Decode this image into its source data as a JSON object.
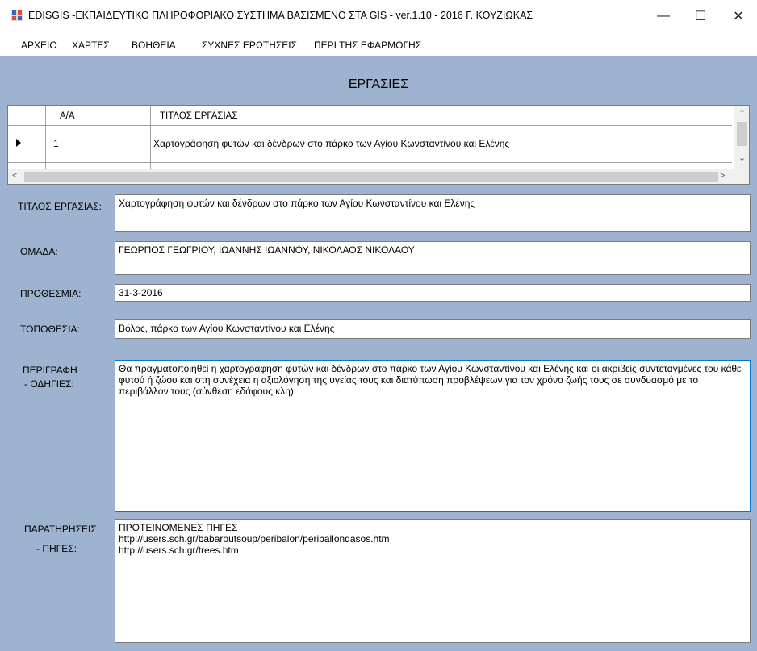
{
  "window": {
    "title": "EDISGIS -ΕΚΠΑΙΔΕΥΤΙΚΟ ΠΛΗΡΟΦΟΡΙΑΚΟ ΣΥΣΤΗΜΑ ΒΑΣΙΣΜΕΝΟ ΣΤΑ GIS - ver.1.10 - 2016 Γ. ΚΟΥΖΙΩΚΑΣ",
    "minimize_glyph": "—",
    "maximize_glyph": "☐",
    "close_glyph": "✕"
  },
  "menu": {
    "items": [
      "ΑΡΧΕΙΟ",
      "ΧΑΡΤΕΣ",
      "ΒΟΗΘΕΙΑ",
      "ΣΥΧΝΕΣ ΕΡΩΤΗΣΕΙΣ",
      "ΠΕΡΙ ΤΗΣ ΕΦΑΡΜΟΓΗΣ"
    ]
  },
  "section_title": "ΕΡΓΑΣΙΕΣ",
  "grid": {
    "columns": [
      "Α/Α",
      "ΤΙΤΛΟΣ ΕΡΓΑΣΙΑΣ"
    ],
    "rows": [
      {
        "aa": "1",
        "title": "Χαρτογράφηση φυτών και δένδρων στο πάρκο των Αγίου Κωνσταντίνου και Ελένης"
      }
    ]
  },
  "form": {
    "title_label": "ΤΙΤΛΟΣ ΕΡΓΑΣΙΑΣ:",
    "title_value": "Χαρτογράφηση φυτών και δένδρων στο πάρκο των Αγίου Κωνσταντίνου και Ελένης",
    "team_label": "ΟΜΑΔΑ:",
    "team_value": "ΓΕΩΡΠΟΣ ΓΕΩΓΡΙΟΥ, ΙΩΑΝΝΗΣ ΙΩΑΝΝΟΥ, ΝΙΚΟΛΑΟΣ ΝΙΚΟΛΑΟΥ",
    "deadline_label": "ΠΡΟΘΕΣΜΙΑ:",
    "deadline_value": "31-3-2016",
    "location_label": "ΤΟΠΟΘΕΣΙΑ:",
    "location_value": "Βόλος, πάρκο των Αγίου Κωνσταντίνου και Ελένης",
    "description_label_1": "ΠΕΡΙΓΡΑΦΗ",
    "description_label_2": "- ΟΔΗΓΙΕΣ:",
    "description_value": "Θα πραγματοποιηθεί η χαρτογράφηση φυτών και δένδρων στο πάρκο των Αγίου Κωνσταντίνου και Ελένης και οι ακριβείς συντεταγμένες του κάθε φυτού ή ζώου και στη συνέχεια η αξιολόγηση της υγείας τους και διατύπωση προβλέψεων για τον χρόνο ζωής τους σε συνδυασμό με το περιβάλλον τους (σύνθεση εδάφους κλη).",
    "notes_label_1": "ΠΑΡΑΤΗΡΗΣΕΙΣ",
    "notes_label_2": "- ΠΗΓΕΣ:",
    "notes_value": "ΠΡΟΤΕΙΝΟΜΕΝΕΣ ΠΗΓΕΣ\nhttp://users.sch.gr/babaroutsoup/peribalon/periballondasos.htm\nhttp://users.sch.gr/trees.htm"
  },
  "colors": {
    "background": "#9db3cf",
    "focus_border": "#0078d7"
  }
}
